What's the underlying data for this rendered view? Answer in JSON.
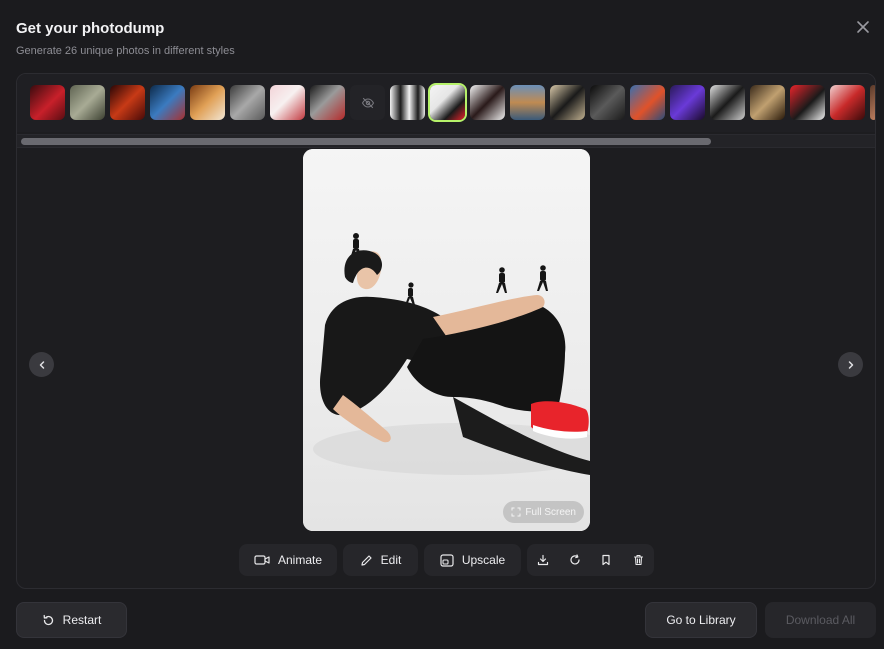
{
  "header": {
    "title": "Get your photodump",
    "subtitle": "Generate 26 unique photos in different styles"
  },
  "preview": {
    "fullscreen_label": "Full Screen"
  },
  "actions": {
    "animate_label": "Animate",
    "edit_label": "Edit",
    "upscale_label": "Upscale"
  },
  "footer": {
    "restart_label": "Restart",
    "library_label": "Go to Library",
    "download_all_label": "Download All"
  },
  "thumbnails": {
    "count_visible": 22,
    "selected_index": 10,
    "hidden_index": 8
  },
  "colors": {
    "accent_selected": "#b6f26a",
    "sneaker_red": "#e8242b"
  }
}
